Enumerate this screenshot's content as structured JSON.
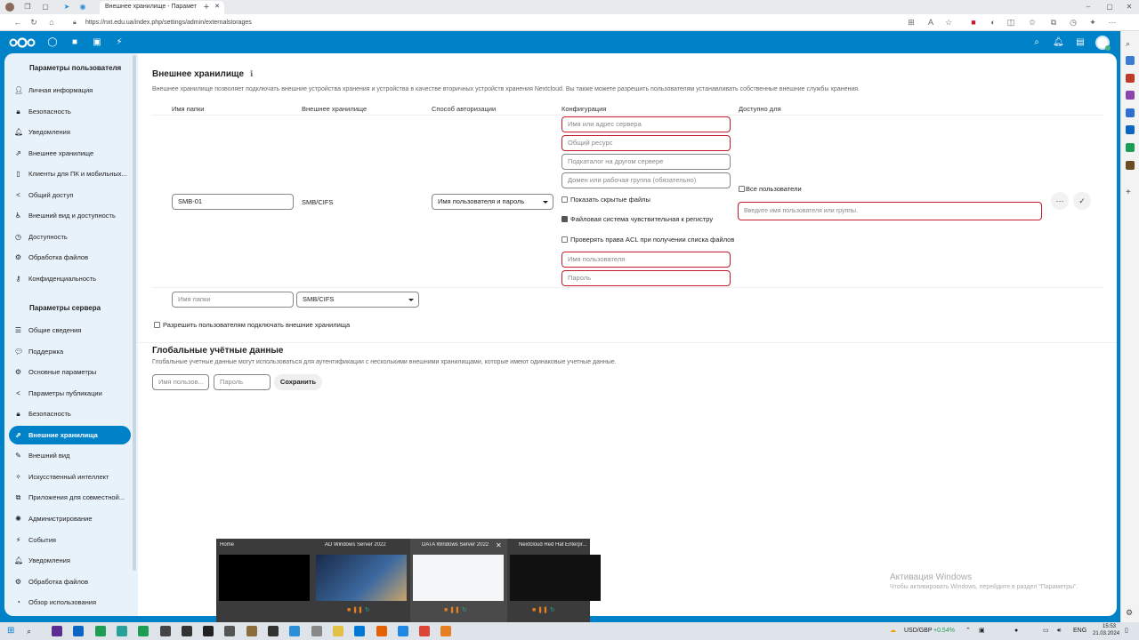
{
  "browser": {
    "tab_title": "Внешнее хранилище - Парамет",
    "url": "https://nxt.edu.ua/index.php/settings/admin/externalstorages"
  },
  "nav": {
    "user_section": "Параметры пользователя",
    "user_items": [
      {
        "label": "Личная информация",
        "icon": "person-icon"
      },
      {
        "label": "Безопасность",
        "icon": "lock-icon"
      },
      {
        "label": "Уведомления",
        "icon": "bell-icon"
      },
      {
        "label": "Внешнее хранилище",
        "icon": "external-icon"
      },
      {
        "label": "Клиенты для ПК и мобильных...",
        "icon": "phone-icon"
      },
      {
        "label": "Общий доступ",
        "icon": "share-icon"
      },
      {
        "label": "Внешний вид и доступность",
        "icon": "accessibility-icon"
      },
      {
        "label": "Доступность",
        "icon": "clock-icon"
      },
      {
        "label": "Обработка файлов",
        "icon": "cog-icon"
      },
      {
        "label": "Конфиденциальность",
        "icon": "key-icon"
      }
    ],
    "server_section": "Параметры сервера",
    "server_items": [
      {
        "label": "Общие сведения",
        "icon": "list-icon"
      },
      {
        "label": "Поддержка",
        "icon": "chat-icon"
      },
      {
        "label": "Основные параметры",
        "icon": "gear-icon"
      },
      {
        "label": "Параметры публикации",
        "icon": "share-icon"
      },
      {
        "label": "Безопасность",
        "icon": "lock-icon"
      },
      {
        "label": "Внешние хранилища",
        "icon": "external-icon",
        "active": true
      },
      {
        "label": "Внешний вид",
        "icon": "brush-icon"
      },
      {
        "label": "Искусственный интеллект",
        "icon": "ai-icon"
      },
      {
        "label": "Приложения для совместной...",
        "icon": "apps-icon"
      },
      {
        "label": "Администрирование",
        "icon": "admin-icon"
      },
      {
        "label": "События",
        "icon": "flash-icon"
      },
      {
        "label": "Уведомления",
        "icon": "bell-icon"
      },
      {
        "label": "Обработка файлов",
        "icon": "cog-icon"
      },
      {
        "label": "Обзор использования",
        "icon": "chart-icon"
      }
    ]
  },
  "main": {
    "title": "Внешнее хранилище",
    "description": "Внешнее хранилище позволяет подключать внешние устройства хранения и устройства в качестве вторичных устройств хранения Nextcloud. Вы также можете разрешить пользователям устанавливать собственные внешние службы хранения.",
    "columns": {
      "folder": "Имя папки",
      "storage": "Внешнее хранилище",
      "auth": "Способ авторизации",
      "config": "Конфигурация",
      "available": "Доступно для"
    },
    "row": {
      "folder_value": "SMB-01",
      "storage": "SMB/CIFS",
      "auth_selected": "Имя пользователя и пароль",
      "host_ph": "Имя или адрес сервера",
      "share_ph": "Общий ресурс",
      "subfolder_ph": "Подкаталог на другом сервере",
      "domain_ph": "Домен или рабочая группа (обязательно)",
      "show_hidden": "Показать скрытые файлы",
      "case_sensitive": "Файловая система чувствительная к регистру",
      "check_acl": "Проверять права ACL при получении списка файлов",
      "user_ph": "Имя пользователя",
      "password_ph": "Пароль",
      "all_users": "Все пользователи",
      "user_group_ph": "Введите имя пользователя или группы."
    },
    "new_row": {
      "folder_ph": "Имя папки",
      "storage_selected": "SMB/CIFS"
    },
    "allow_users": "Разрешить пользователям подключать внешние хранилища",
    "global_title": "Глобальные учётные данные",
    "global_desc": "Глобальные учетные данные могут использоваться для аутентификации с несколькими внешними хранилищами, которые имеют одинаковые учетные данные.",
    "global_user_ph": "Имя пользов...",
    "global_pass_ph": "Пароль",
    "save_label": "Сохранить"
  },
  "task_preview": [
    {
      "title": "Home"
    },
    {
      "title": "AD Windows Server 2022"
    },
    {
      "title": "DATA Windows Server 2022"
    },
    {
      "title": "Nextcloud Red Hat Enterpr..."
    }
  ],
  "watermark": {
    "line1": "Активация Windows",
    "line2": "Чтобы активировать Windows, перейдите в раздел \"Параметры\"."
  },
  "taskbar": {
    "ticker": "USD/GBP",
    "change": "+0.54%",
    "lang": "ENG",
    "time": "15:53",
    "date": "21.03.2024"
  },
  "colors": {
    "brand": "#0082c9",
    "error": "#c21d2e"
  }
}
